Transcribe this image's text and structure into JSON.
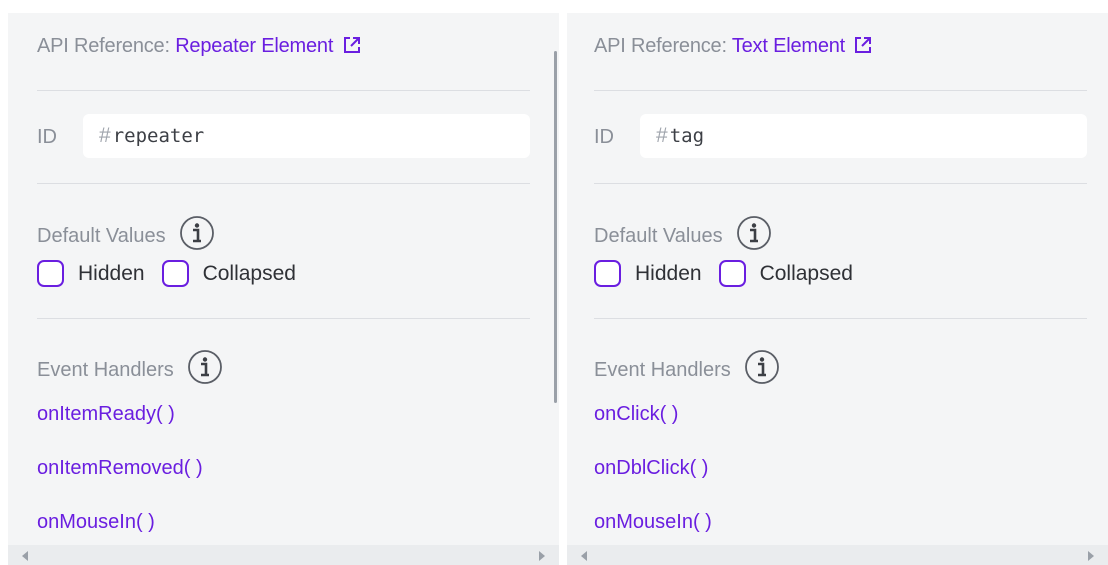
{
  "panels": [
    {
      "api_prefix": "API Reference: ",
      "api_link": "Repeater Element",
      "id_label": "ID",
      "id_hash": "#",
      "id_value": "repeater",
      "default_values_label": "Default Values",
      "checkbox_hidden": "Hidden",
      "checkbox_collapsed": "Collapsed",
      "event_handlers_label": "Event Handlers",
      "handlers": [
        "onItemReady( )",
        "onItemRemoved( )",
        "onMouseIn( )"
      ]
    },
    {
      "api_prefix": "API Reference: ",
      "api_link": "Text Element",
      "id_label": "ID",
      "id_hash": "#",
      "id_value": "tag",
      "default_values_label": "Default Values",
      "checkbox_hidden": "Hidden",
      "checkbox_collapsed": "Collapsed",
      "event_handlers_label": "Event Handlers",
      "handlers": [
        "onClick( )",
        "onDblClick( )",
        "onMouseIn( )"
      ]
    }
  ],
  "colors": {
    "accent": "#6a1ee0",
    "panel_bg": "#f4f5f6",
    "muted_text": "#8a8f98"
  },
  "icons": {
    "external_link": "external-link-icon",
    "info": "info-icon"
  }
}
